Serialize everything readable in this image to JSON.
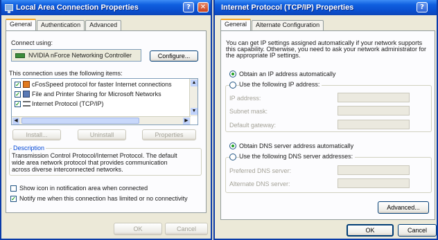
{
  "left_window": {
    "title": "Local Area Connection Properties",
    "tabs": [
      "General",
      "Authentication",
      "Advanced"
    ],
    "connect_using_label": "Connect using:",
    "adapter_name": "NVIDIA nForce Networking Controller",
    "configure_button": "Configure...",
    "items_label": "This connection uses the following items:",
    "items": [
      {
        "label": "cFosSpeed protocol for faster Internet connections",
        "checked": true
      },
      {
        "label": "File and Printer Sharing for Microsoft Networks",
        "checked": true
      },
      {
        "label": "Internet Protocol (TCP/IP)",
        "checked": true
      }
    ],
    "install_button": "Install...",
    "uninstall_button": "Uninstall",
    "properties_button": "Properties",
    "description_title": "Description",
    "description_text_1": "Transmission Control Protocol/Internet Protocol. The default",
    "description_text_2": "wide area network protocol that provides communication",
    "description_text_3": "across diverse interconnected networks.",
    "show_icon_label": "Show icon in notification area when connected",
    "show_icon_checked": false,
    "notify_label": "Notify me when this connection has limited or no connectivity",
    "notify_checked": true,
    "ok_button": "OK",
    "cancel_button": "Cancel"
  },
  "right_window": {
    "title": "Internet Protocol (TCP/IP) Properties",
    "tabs": [
      "General",
      "Alternate Configuration"
    ],
    "intro_1": "You can get IP settings assigned automatically if your network supports",
    "intro_2": "this capability. Otherwise, you need to ask your network administrator for",
    "intro_3": "the appropriate IP settings.",
    "obtain_ip_auto": "Obtain an IP address automatically",
    "use_following_ip": "Use the following IP address:",
    "ip_address_label": "IP address:",
    "subnet_mask_label": "Subnet mask:",
    "default_gateway_label": "Default gateway:",
    "obtain_dns_auto": "Obtain DNS server address automatically",
    "use_following_dns": "Use the following DNS server addresses:",
    "preferred_dns_label": "Preferred DNS server:",
    "alternate_dns_label": "Alternate DNS server:",
    "advanced_button": "Advanced...",
    "ok_button": "OK",
    "cancel_button": "Cancel"
  },
  "colors": {
    "titlebar": "#0a4fcf",
    "dialog_bg": "#ece9d8",
    "check_green": "#21a121"
  },
  "icons": [
    "network-connection-icon",
    "help-icon",
    "close-icon",
    "network-adapter-icon",
    "protocol-icon",
    "file-printer-icon",
    "scroll-up-icon",
    "scroll-down-icon",
    "scroll-left-icon",
    "scroll-right-icon"
  ]
}
